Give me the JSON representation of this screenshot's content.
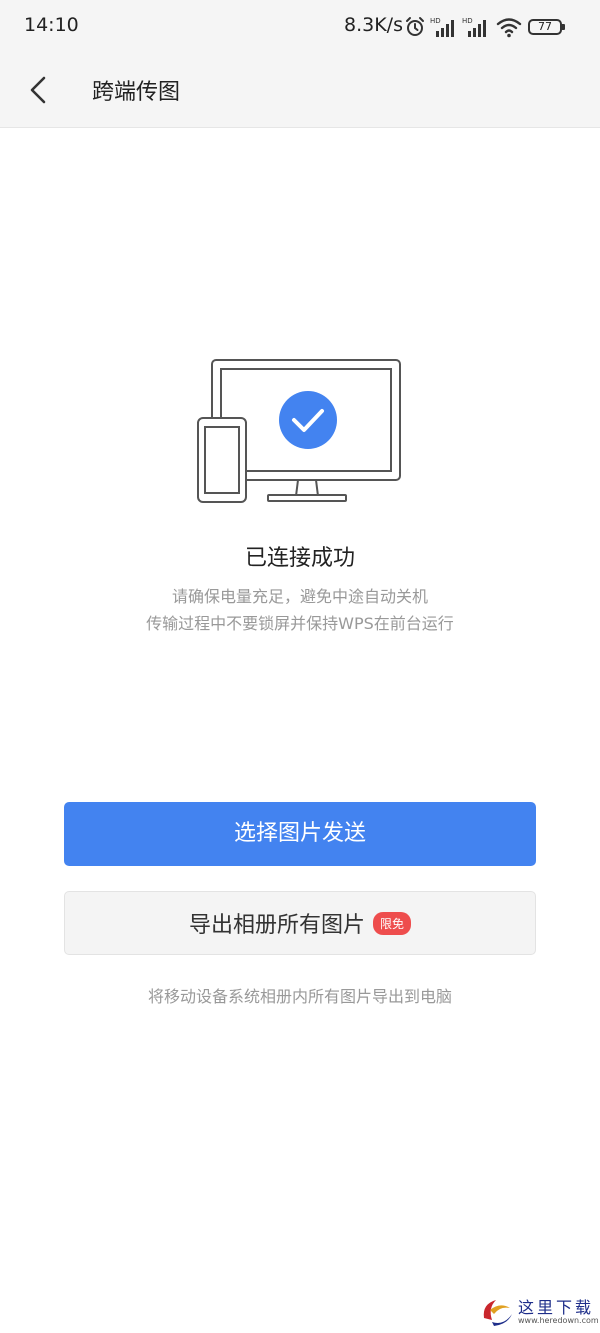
{
  "status_bar": {
    "time": "14:10",
    "network_speed": "8.3K/s",
    "battery_level": "77",
    "icons": [
      "alarm-icon",
      "signal-hd-icon",
      "signal-hd-icon",
      "wifi-icon",
      "battery-icon"
    ]
  },
  "header": {
    "back_icon": "chevron-left-icon",
    "title": "跨端传图"
  },
  "status": {
    "illustration": "phone-connected-to-monitor-icon",
    "check_color": "#4383f0",
    "title": "已连接成功",
    "note_line1": "请确保电量充足，避免中途自动关机",
    "note_line2": "传输过程中不要锁屏并保持WPS在前台运行"
  },
  "actions": {
    "primary_label": "选择图片发送",
    "primary_color": "#4383f0",
    "secondary_label": "导出相册所有图片",
    "secondary_badge": "限免",
    "badge_color": "#ee4d4d",
    "secondary_hint": "将移动设备系统相册内所有图片导出到电脑"
  },
  "watermark": {
    "text": "这里下载",
    "url": "www.heredown.com"
  }
}
